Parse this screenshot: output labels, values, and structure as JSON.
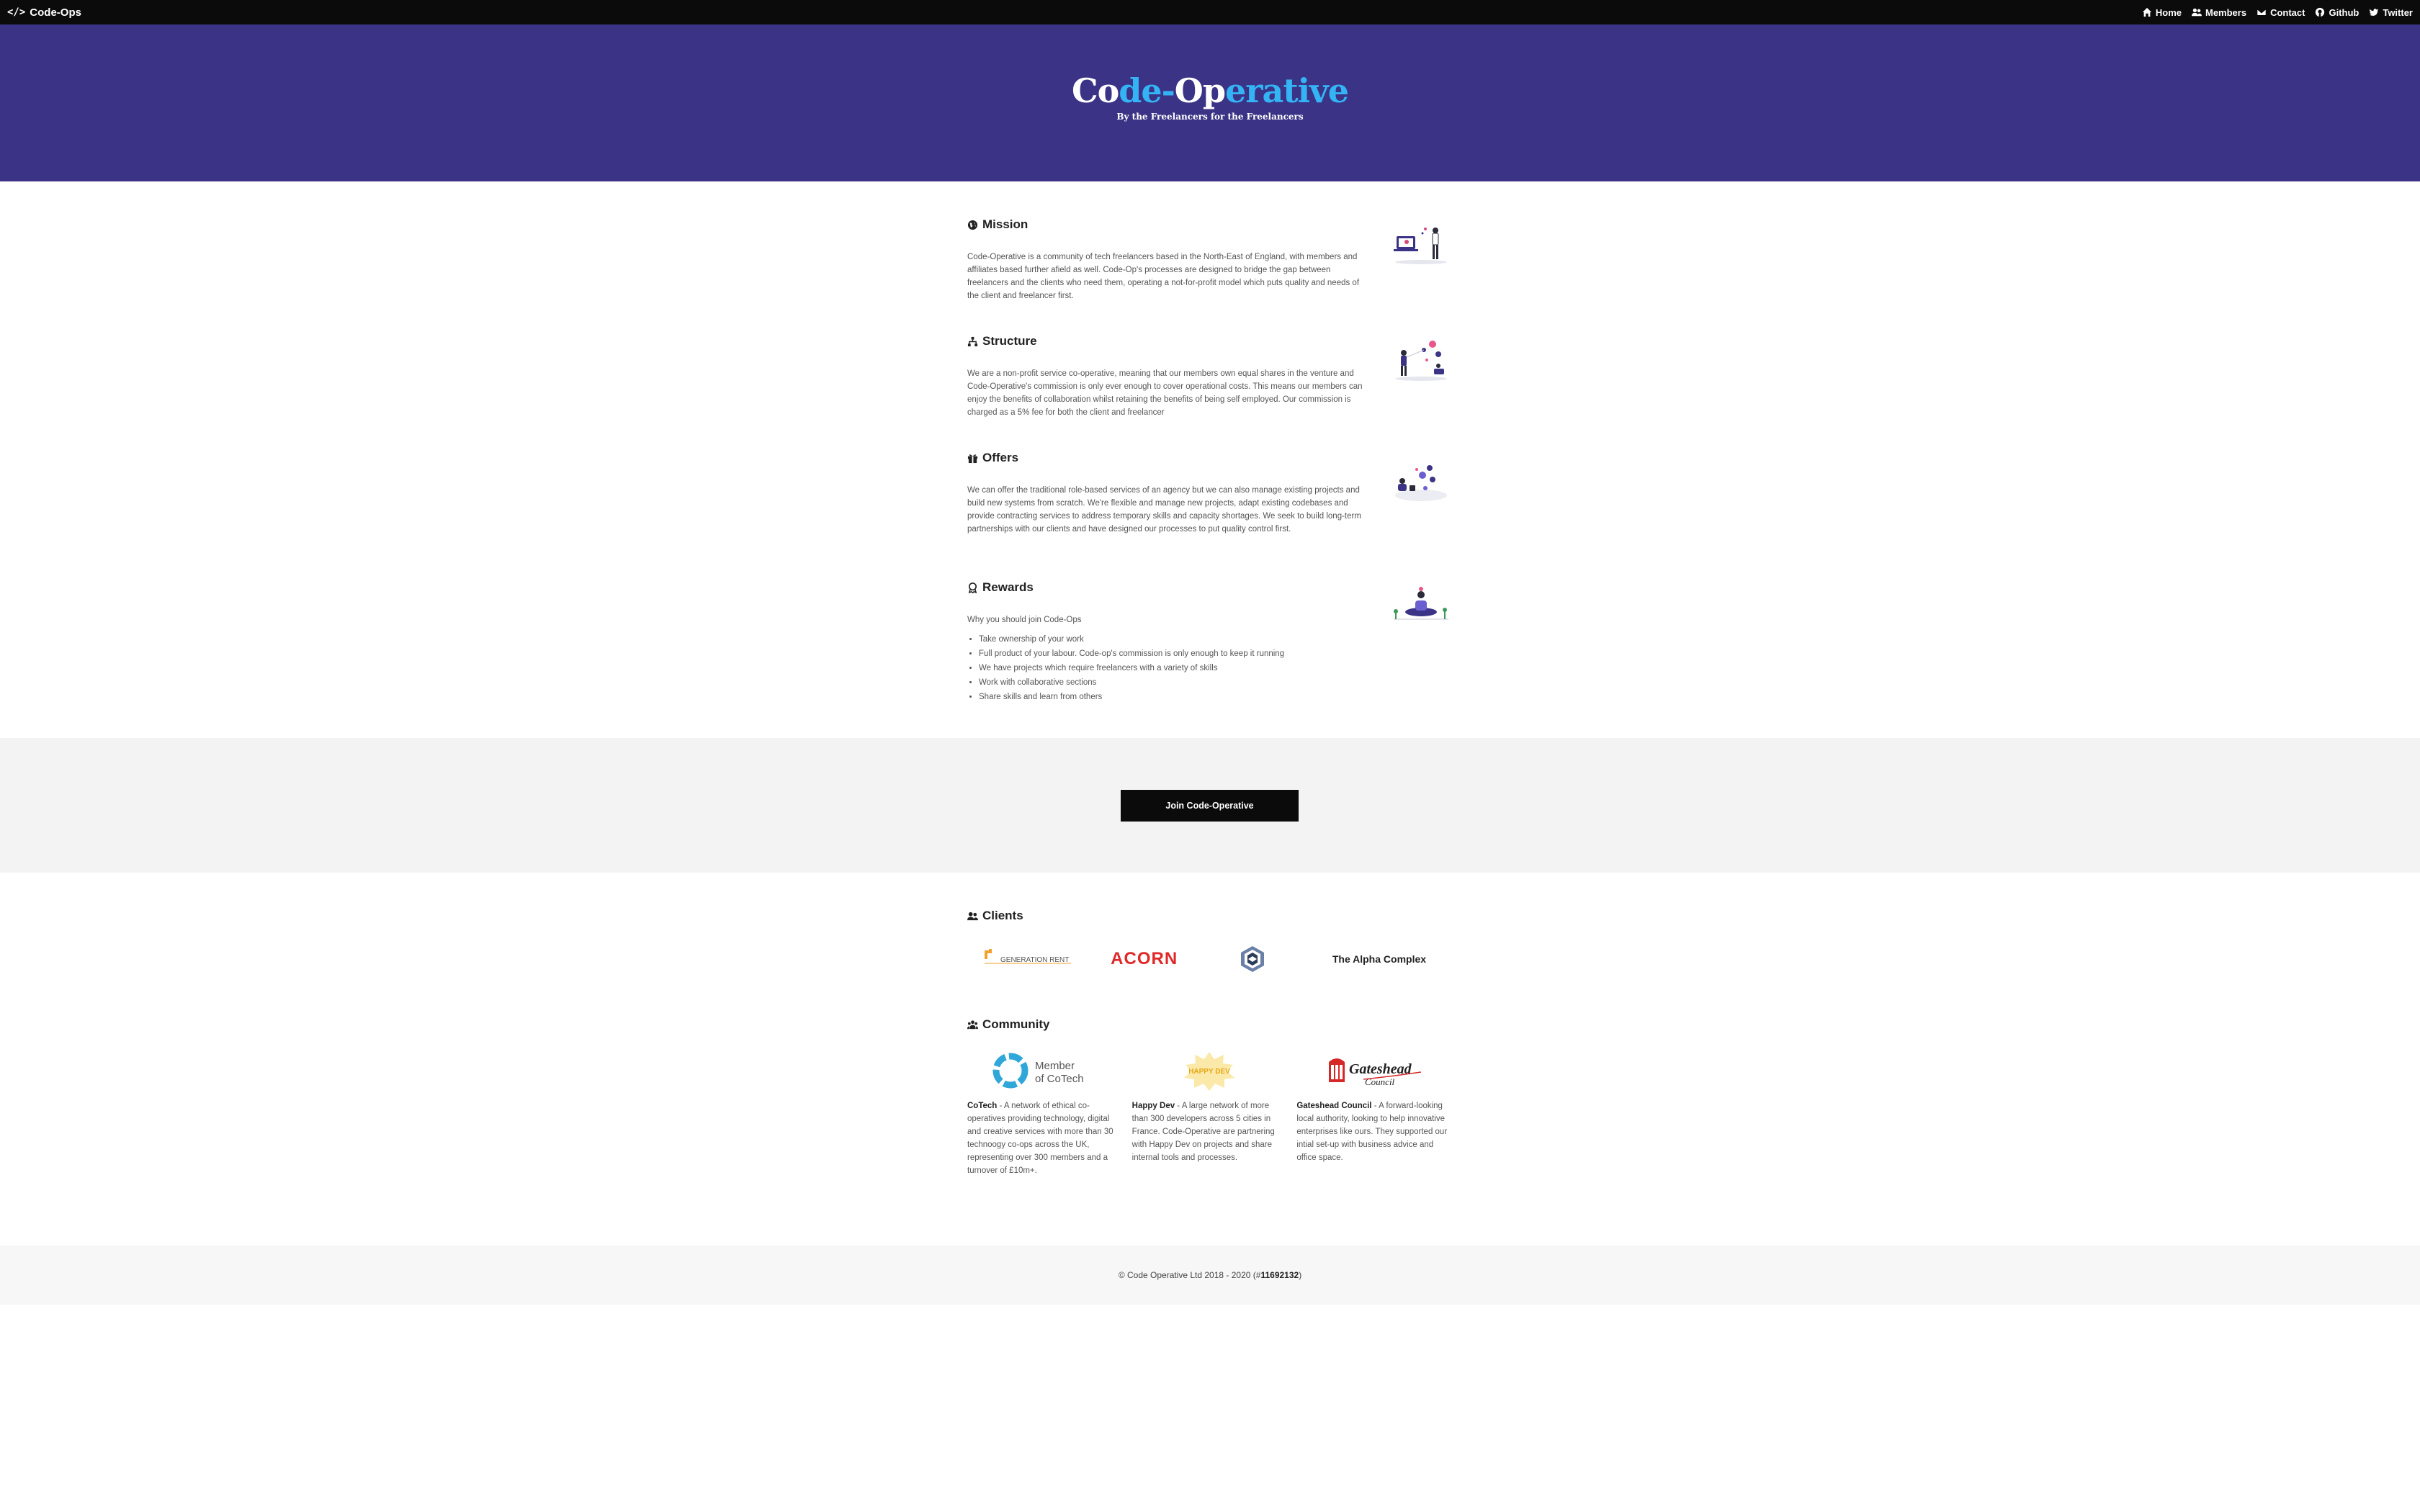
{
  "navbar": {
    "brand_glyph": "</>",
    "brand": "Code-Ops",
    "links": {
      "home": "Home",
      "members": "Members",
      "contact": "Contact",
      "github": "Github",
      "twitter": "Twitter"
    }
  },
  "hero": {
    "title_part1": "Co",
    "title_part2": "de-",
    "title_part3": "Op",
    "title_part4": "erative",
    "subtitle": "By the Freelancers for the Freelancers",
    "colors": {
      "background": "#3b3486",
      "accent": "#34b3f5"
    }
  },
  "sections": {
    "mission": {
      "heading": "Mission",
      "text": "Code-Operative is a community of tech freelancers based in the North-East of England, with members and affiliates based further afield as well. Code-Op's processes are designed to bridge the gap between freelancers and the clients who need them, operating a not-for-profit model which puts quality and needs of the client and freelancer first."
    },
    "structure": {
      "heading": "Structure",
      "text": "We are a non-profit service co-operative, meaning that our members own equal shares in the venture and Code-Operative's commission is only ever enough to cover operational costs. This means our members can enjoy the benefits of collaboration whilst retaining the benefits of being self employed. Our commission is charged as a 5% fee for both the client and freelancer"
    },
    "offers": {
      "heading": "Offers",
      "text": "We can offer the traditional role-based services of an agency but we can also manage existing projects and build new systems from scratch. We're flexible and manage new projects, adapt existing codebases and provide contracting services to address temporary skills and capacity shortages. We seek to build long-term partnerships with our clients and have designed our processes to put quality control first."
    },
    "rewards": {
      "heading": "Rewards",
      "intro": "Why you should join Code-Ops",
      "items": [
        "Take ownership of your work",
        "Full product of your labour. Code-op's commission is only enough to keep it running",
        "We have projects which require freelancers with a variety of skills",
        "Work with collaborative sections",
        "Share skills and learn from others"
      ]
    }
  },
  "cta": {
    "join_label": "Join Code-Operative"
  },
  "clients": {
    "heading": "Clients",
    "logos": {
      "generation_rent": "GENERATION RENT",
      "acorn": "ACORN",
      "alpha_complex": "The Alpha Complex"
    }
  },
  "community": {
    "heading": "Community",
    "cotech": {
      "logo_line1": "Member",
      "logo_line2": "of CoTech",
      "name": "CoTech",
      "text": " - A network of ethical co-operatives providing technology, digital and creative services with more than 30 technoogy co-ops across the UK, representing over 300 members and a turnover of £10m+."
    },
    "happydev": {
      "logo_text": "HAPPY DEV",
      "name": "Happy Dev",
      "text": " - A large network of more than 300 developers across 5 cities in France. Code-Operative are partnering with Happy Dev on projects and share internal tools and processes."
    },
    "gateshead": {
      "logo_line1": "Gateshead",
      "logo_line2": "Council",
      "name": "Gateshead Council",
      "text": " - A forward-looking local authority, looking to help innovative enterprises like ours. They supported our intial set-up with business advice and office space."
    }
  },
  "footer": {
    "text": "© Code Operative Ltd 2018 - 2020 (#",
    "reg": "11692132",
    "close": ")"
  }
}
